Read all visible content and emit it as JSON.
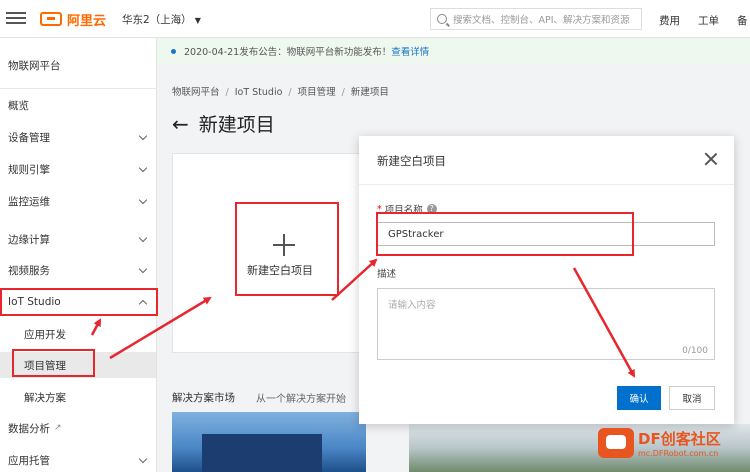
{
  "topbar": {
    "logo_text": "阿里云",
    "region": "华东2（上海）",
    "search_placeholder": "搜索文档、控制台、API、解决方案和资源",
    "nav": [
      "费用",
      "工单",
      "备"
    ]
  },
  "sidebar": {
    "title": "物联网平台",
    "items": [
      {
        "label": "概览"
      },
      {
        "label": "设备管理"
      },
      {
        "label": "规则引擎"
      },
      {
        "label": "监控运维"
      },
      {
        "label": "边缘计算"
      },
      {
        "label": "视频服务"
      },
      {
        "label": "IoT Studio"
      },
      {
        "label": "应用开发"
      },
      {
        "label": "项目管理"
      },
      {
        "label": "解决方案"
      },
      {
        "label": "数据分析"
      },
      {
        "label": "应用托管"
      }
    ]
  },
  "notice": {
    "text": "2020-04-21发布公告：物联网平台新功能发布！",
    "link": "查看详情"
  },
  "breadcrumb": [
    "物联网平台",
    "IoT Studio",
    "项目管理",
    "新建项目"
  ],
  "page": {
    "title": "新建项目",
    "card_label": "新建空白项目",
    "market_title": "解决方案市场",
    "market_sub": "从一个解决方案开始"
  },
  "dialog": {
    "title": "新建空白项目",
    "name_label": "项目名称",
    "name_value": "GPStracker",
    "desc_label": "描述",
    "desc_placeholder": "请输入内容",
    "counter": "0/100",
    "ok": "确认",
    "cancel": "取消"
  },
  "watermark": {
    "main": "DF创客社区",
    "sub": "mc.DFRobot.com.cn"
  },
  "colors": {
    "brand": "#ff6a00",
    "primary": "#0070cc",
    "annotation": "#e8262e"
  }
}
